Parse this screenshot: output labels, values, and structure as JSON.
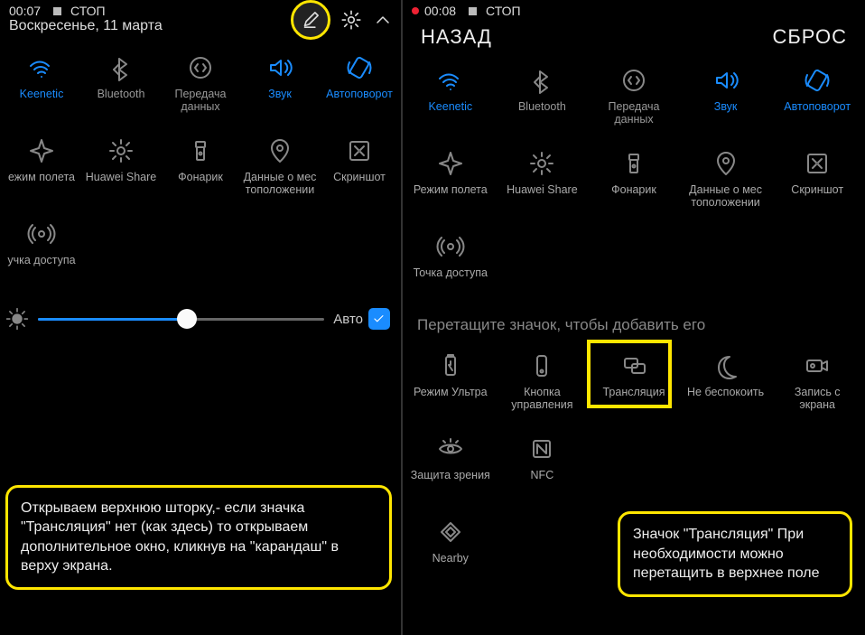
{
  "left": {
    "status_time": "00:07",
    "status_rec": "СТОП",
    "date": "Воскресенье, 11 марта",
    "brightness_auto_label": "Авто",
    "callout": "Открываем верхнюю шторку,- если значка \"Трансляция\" нет (как здесь) то открываем дополнительное окно, кликнув на \"карандаш\" в верху экрана.",
    "tiles_row1": [
      {
        "label": "Keenetic",
        "active": true,
        "icon": "wifi"
      },
      {
        "label": "Bluetooth",
        "active": false,
        "icon": "bluetooth"
      },
      {
        "label": "Передача данных",
        "active": false,
        "icon": "data"
      },
      {
        "label": "Звук",
        "active": true,
        "icon": "sound"
      },
      {
        "label": "Автоповорот",
        "active": true,
        "icon": "rotate"
      }
    ],
    "tiles_row2": [
      {
        "label": "ежим полета",
        "icon": "plane"
      },
      {
        "label": "Huawei Share",
        "icon": "share"
      },
      {
        "label": "Фонарик",
        "icon": "torch"
      },
      {
        "label": "Данные о мес тоположении",
        "icon": "location"
      },
      {
        "label": "Скриншот",
        "icon": "screenshot"
      }
    ],
    "tiles_row3": [
      {
        "label": "учка доступа",
        "icon": "hotspot"
      }
    ]
  },
  "right": {
    "status_time": "00:08",
    "status_rec": "СТОП",
    "back_label": "НАЗАД",
    "reset_label": "СБРОС",
    "drag_hint": "Перетащите значок, чтобы добавить его",
    "callout": "Значок \"Трансляция\" При необходимости можно перетащить в верхнее поле",
    "tiles_row1": [
      {
        "label": "Keenetic",
        "active": true,
        "icon": "wifi"
      },
      {
        "label": "Bluetooth",
        "active": false,
        "icon": "bluetooth"
      },
      {
        "label": "Передача данных",
        "active": false,
        "icon": "data"
      },
      {
        "label": "Звук",
        "active": true,
        "icon": "sound"
      },
      {
        "label": "Автоповорот",
        "active": true,
        "icon": "rotate"
      }
    ],
    "tiles_row2": [
      {
        "label": "Режим полета",
        "icon": "plane"
      },
      {
        "label": "Huawei Share",
        "icon": "share"
      },
      {
        "label": "Фонарик",
        "icon": "torch"
      },
      {
        "label": "Данные о мес тоположении",
        "icon": "location"
      },
      {
        "label": "Скриншот",
        "icon": "screenshot"
      }
    ],
    "tiles_row3": [
      {
        "label": "Точка доступа",
        "icon": "hotspot"
      }
    ],
    "extra_row1": [
      {
        "label": "Режим Ультра",
        "icon": "battery"
      },
      {
        "label": "Кнопка управления",
        "icon": "navdot"
      },
      {
        "label": "Трансляция",
        "icon": "cast"
      },
      {
        "label": "Не беспокоить",
        "icon": "moon"
      },
      {
        "label": "Запись с экрана",
        "icon": "record"
      }
    ],
    "extra_row2": [
      {
        "label": "Защита зрения",
        "icon": "eye"
      },
      {
        "label": "NFC",
        "icon": "nfc"
      }
    ],
    "extra_row3": [
      {
        "label": "Nearby",
        "icon": "nearby"
      }
    ]
  }
}
